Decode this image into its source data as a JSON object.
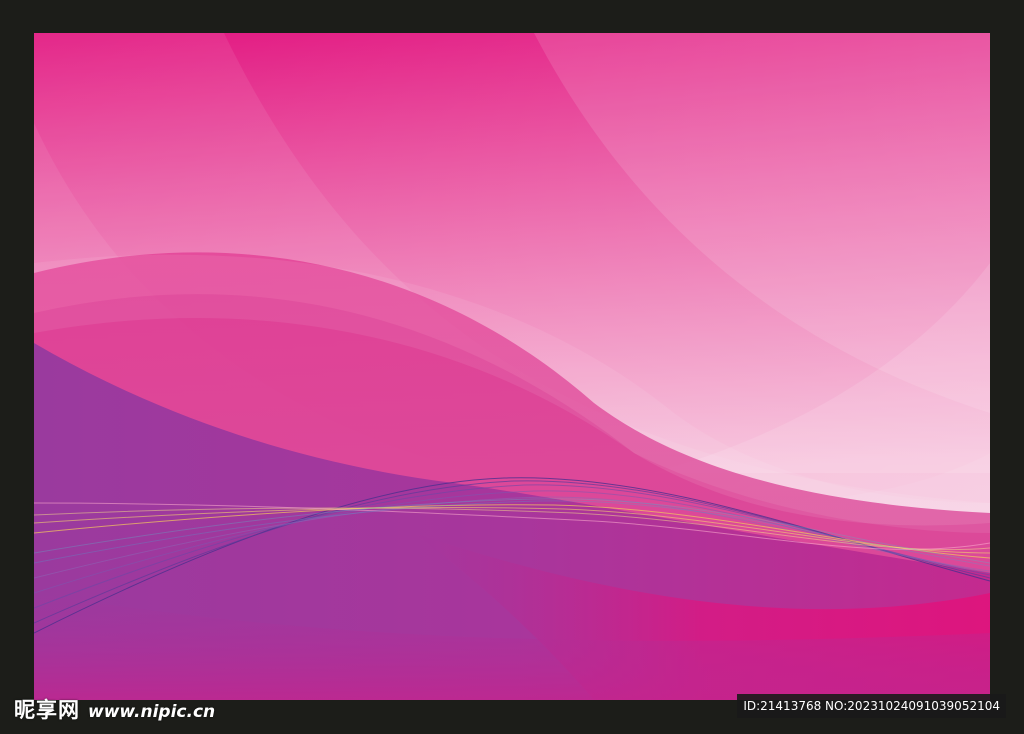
{
  "image": {
    "frame_color": "#1c1d19",
    "colors": {
      "sky_top": "#e21680",
      "sky_light": "#f6c2dc",
      "magenta": "#df2a8a",
      "purple": "#9b3a9e",
      "deep_pink": "#e0137c"
    }
  },
  "watermark": {
    "logo": "昵享网",
    "url": "www.nipic.cn",
    "id_text": "ID:21413768 NO:20231024091039052104"
  }
}
